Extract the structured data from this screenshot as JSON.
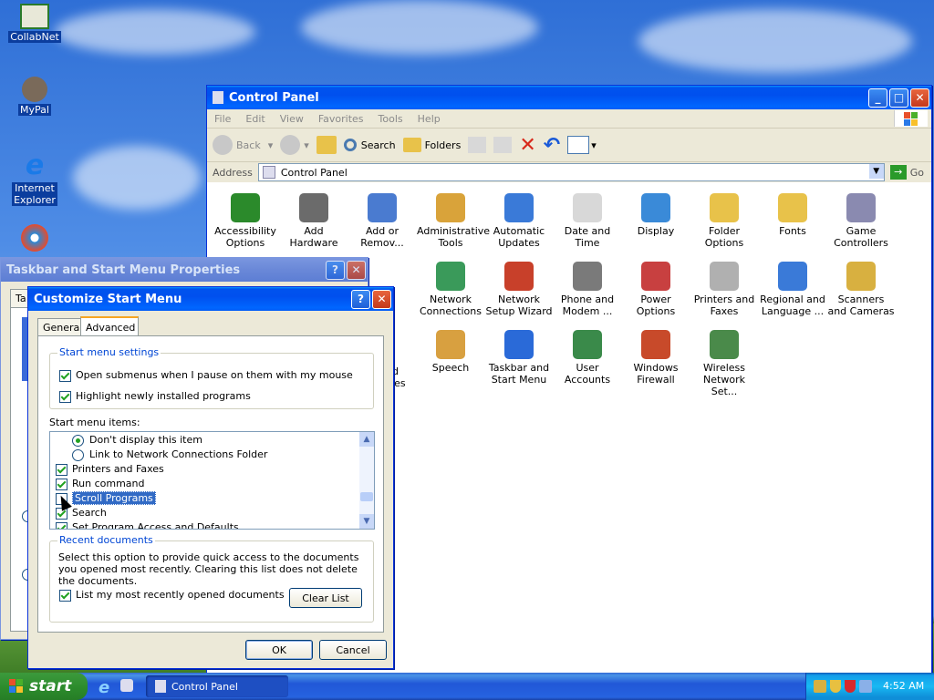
{
  "desktop": {
    "icons": [
      {
        "label": "CollabNet"
      },
      {
        "label": "MyPal"
      },
      {
        "label": "Internet Explorer"
      }
    ]
  },
  "control_panel": {
    "title": "Control Panel",
    "menu": [
      "File",
      "Edit",
      "View",
      "Favorites",
      "Tools",
      "Help"
    ],
    "toolbar": {
      "back": "Back",
      "search": "Search",
      "folders": "Folders"
    },
    "address_label": "Address",
    "address_value": "Control Panel",
    "go_label": "Go",
    "items": [
      {
        "label": "Accessibility Options",
        "color": "#2b8a2b"
      },
      {
        "label": "Add Hardware",
        "color": "#6b6b6b"
      },
      {
        "label": "Add or Remov...",
        "color": "#4a7bd0"
      },
      {
        "label": "Administrative Tools",
        "color": "#d9a33a"
      },
      {
        "label": "Automatic Updates",
        "color": "#3a7ad8"
      },
      {
        "label": "Date and Time",
        "color": "#d8d8d8"
      },
      {
        "label": "Display",
        "color": "#3a8ad8"
      },
      {
        "label": "Folder Options",
        "color": "#e8c24a"
      },
      {
        "label": "Fonts",
        "color": "#e8c24a"
      },
      {
        "label": "Game Controllers",
        "color": "#8a8ab0"
      },
      {
        "label": "Network Connections",
        "color": "#3a9a5a"
      },
      {
        "label": "Network Setup Wizard",
        "color": "#c8402a"
      },
      {
        "label": "Phone and Modem ...",
        "color": "#7a7a7a"
      },
      {
        "label": "Power Options",
        "color": "#c84040"
      },
      {
        "label": "Printers and Faxes",
        "color": "#b0b0b0"
      },
      {
        "label": "Regional and Language ...",
        "color": "#3a7ad8"
      },
      {
        "label": "Scanners and Cameras",
        "color": "#d8b040"
      },
      {
        "label": "Speech",
        "color": "#d8a040"
      },
      {
        "label": "Taskbar and Start Menu",
        "color": "#2a6ad8"
      },
      {
        "label": "User Accounts",
        "color": "#3a8a4a"
      },
      {
        "label": "Windows Firewall",
        "color": "#c84a2a"
      },
      {
        "label": "Wireless Network Set...",
        "color": "#4a8a4a"
      }
    ],
    "partial_text_1": "nd",
    "partial_text_2": "ices"
  },
  "taskbar_props": {
    "title": "Taskbar and Start Menu Properties",
    "tab_partial": "Ta"
  },
  "customize": {
    "title": "Customize Start Menu",
    "tabs": {
      "general": "General",
      "advanced": "Advanced"
    },
    "settings_group": "Start menu settings",
    "opt_submenus": "Open submenus when I pause on them with my mouse",
    "opt_highlight": "Highlight newly installed programs",
    "items_label": "Start menu items:",
    "list": {
      "dont_display": "Don't display this item",
      "link_network": "Link to Network Connections Folder",
      "printers": "Printers and Faxes",
      "run": "Run command",
      "scroll": "Scroll Programs",
      "search": "Search",
      "set_program": "Set Program Access and Defaults"
    },
    "recent_group": "Recent documents",
    "recent_desc": "Select this option to provide quick access to the documents you opened most recently.  Clearing this list does not delete the documents.",
    "recent_list": "List my most recently opened documents",
    "clear_list": "Clear List",
    "ok": "OK",
    "cancel": "Cancel"
  },
  "taskbar": {
    "start": "start",
    "task": "Control Panel",
    "clock": "4:52 AM"
  }
}
